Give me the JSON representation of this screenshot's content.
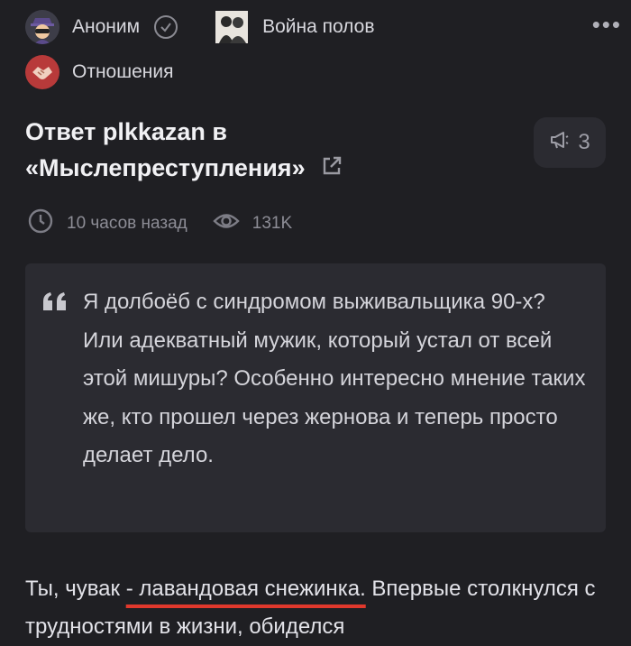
{
  "header": {
    "author": "Аноним",
    "community": "Война полов",
    "more": "•••",
    "tag": "Отношения"
  },
  "post": {
    "title": "Ответ plkkazan в «Мыслепреступления»",
    "comments_count": "3",
    "time": "10 часов назад",
    "views": "131K"
  },
  "quote": {
    "text": "Я долбоёб с синдромом выживальщика 90-х? Или адекватный мужик, который устал от всей этой мишуры? Особенно интересно мнение таких же, кто прошел через жернова и теперь просто делает дело."
  },
  "body": {
    "prefix": "Ты, чувак ",
    "highlight": "- лавандовая снежинка.",
    "suffix": " Впервые столкнулся с трудностями в жизни, обиделся"
  },
  "icons": {
    "avatar": "anonymous-spy-icon",
    "verified": "check-circle-icon",
    "tag": "handshake-icon",
    "comments": "megaphone-icon",
    "time": "clock-icon",
    "views": "eye-icon",
    "external": "external-link-icon",
    "quote": "quote-icon"
  },
  "colors": {
    "background": "#1f1f23",
    "card": "#2b2b31",
    "accent_underline": "#e0382c"
  }
}
